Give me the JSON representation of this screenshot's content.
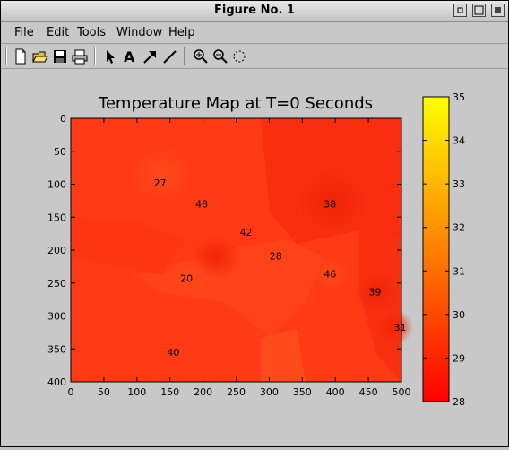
{
  "window": {
    "title": "Figure No. 1"
  },
  "menu": [
    {
      "label": "File"
    },
    {
      "label": "Edit"
    },
    {
      "label": "Tools"
    },
    {
      "label": "Window"
    },
    {
      "label": "Help"
    }
  ],
  "toolbar": {
    "icons": [
      "new-file-icon",
      "open-folder-icon",
      "save-icon",
      "print-icon",
      "select-arrow-icon",
      "insert-text-icon",
      "insert-arrow-icon",
      "insert-line-icon",
      "zoom-in-icon",
      "zoom-out-icon",
      "rotate-icon"
    ]
  },
  "plot": {
    "title": "Temperature Map at T=0 Seconds",
    "x_ticks": [
      "0",
      "50",
      "100",
      "150",
      "200",
      "250",
      "300",
      "350",
      "400",
      "450",
      "500"
    ],
    "y_ticks": [
      "0",
      "50",
      "100",
      "150",
      "200",
      "250",
      "300",
      "350",
      "400"
    ],
    "colorbar_ticks": [
      "35",
      "34",
      "33",
      "32",
      "31",
      "30",
      "29",
      "28"
    ],
    "colorbar_range": [
      28,
      35
    ],
    "colormap": [
      "#ff0000",
      "#ffff00"
    ],
    "labels": [
      {
        "text": "27",
        "x": 135,
        "y": 98
      },
      {
        "text": "48",
        "x": 198,
        "y": 130
      },
      {
        "text": "38",
        "x": 392,
        "y": 130
      },
      {
        "text": "42",
        "x": 265,
        "y": 173
      },
      {
        "text": "28",
        "x": 310,
        "y": 209
      },
      {
        "text": "20",
        "x": 175,
        "y": 243
      },
      {
        "text": "46",
        "x": 392,
        "y": 236
      },
      {
        "text": "39",
        "x": 460,
        "y": 263
      },
      {
        "text": "31",
        "x": 498,
        "y": 317
      },
      {
        "text": "40",
        "x": 155,
        "y": 355
      }
    ]
  },
  "chart_data": {
    "type": "heatmap",
    "title": "Temperature Map at T=0 Seconds",
    "xlim": [
      0,
      500
    ],
    "ylim": [
      0,
      400
    ],
    "y_reversed": true,
    "color_range": [
      28,
      35
    ],
    "colormap": "autumn (red to yellow)",
    "point_labels": [
      {
        "label": "27",
        "x": 135,
        "y": 98
      },
      {
        "label": "48",
        "x": 198,
        "y": 130
      },
      {
        "label": "38",
        "x": 392,
        "y": 130
      },
      {
        "label": "42",
        "x": 265,
        "y": 173
      },
      {
        "label": "28",
        "x": 310,
        "y": 209
      },
      {
        "label": "20",
        "x": 175,
        "y": 243
      },
      {
        "label": "46",
        "x": 392,
        "y": 236
      },
      {
        "label": "39",
        "x": 460,
        "y": 263
      },
      {
        "label": "31",
        "x": 498,
        "y": 317
      },
      {
        "label": "40",
        "x": 155,
        "y": 355
      }
    ]
  }
}
